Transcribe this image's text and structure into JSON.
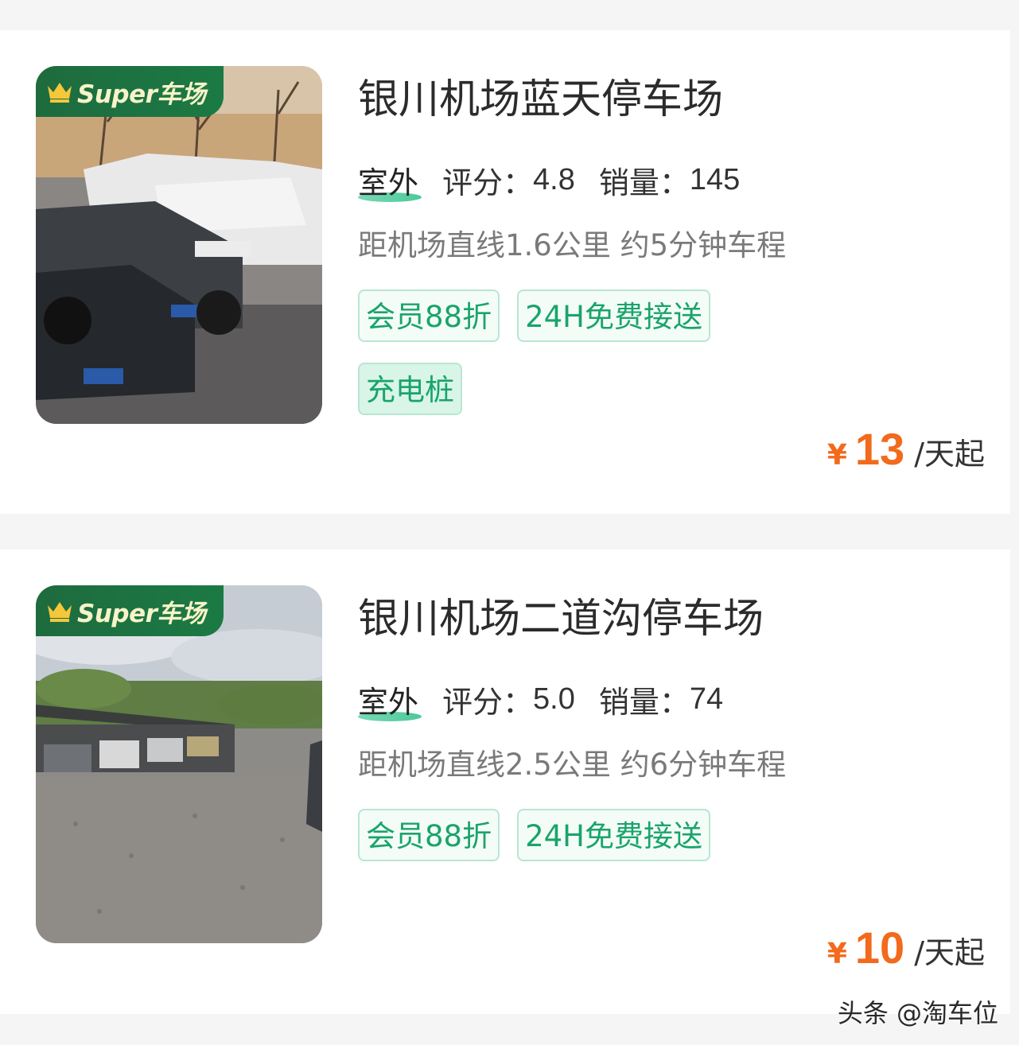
{
  "listings": [
    {
      "badge": "Super车场",
      "title": "银川机场蓝天停车场",
      "kind": "室外",
      "rating_label": "评分：",
      "rating": "4.8",
      "sales_label": "销量：",
      "sales": "145",
      "distance": "距机场直线1.6公里 约5分钟车程",
      "tags": [
        "会员88折",
        "24H免费接送",
        "充电桩"
      ],
      "currency": "¥",
      "price": "13",
      "price_unit": "/天起"
    },
    {
      "badge": "Super车场",
      "title": "银川机场二道沟停车场",
      "kind": "室外",
      "rating_label": "评分：",
      "rating": "5.0",
      "sales_label": "销量：",
      "sales": "74",
      "distance": "距机场直线2.5公里 约6分钟车程",
      "tags": [
        "会员88折",
        "24H免费接送"
      ],
      "currency": "¥",
      "price": "10",
      "price_unit": "/天起"
    }
  ],
  "watermark": "头条 @淘车位",
  "colors": {
    "accent_green": "#1aa46a",
    "badge_green": "#1e6b3e",
    "price_orange": "#f26a1b"
  },
  "icons": [
    "crown-icon"
  ]
}
